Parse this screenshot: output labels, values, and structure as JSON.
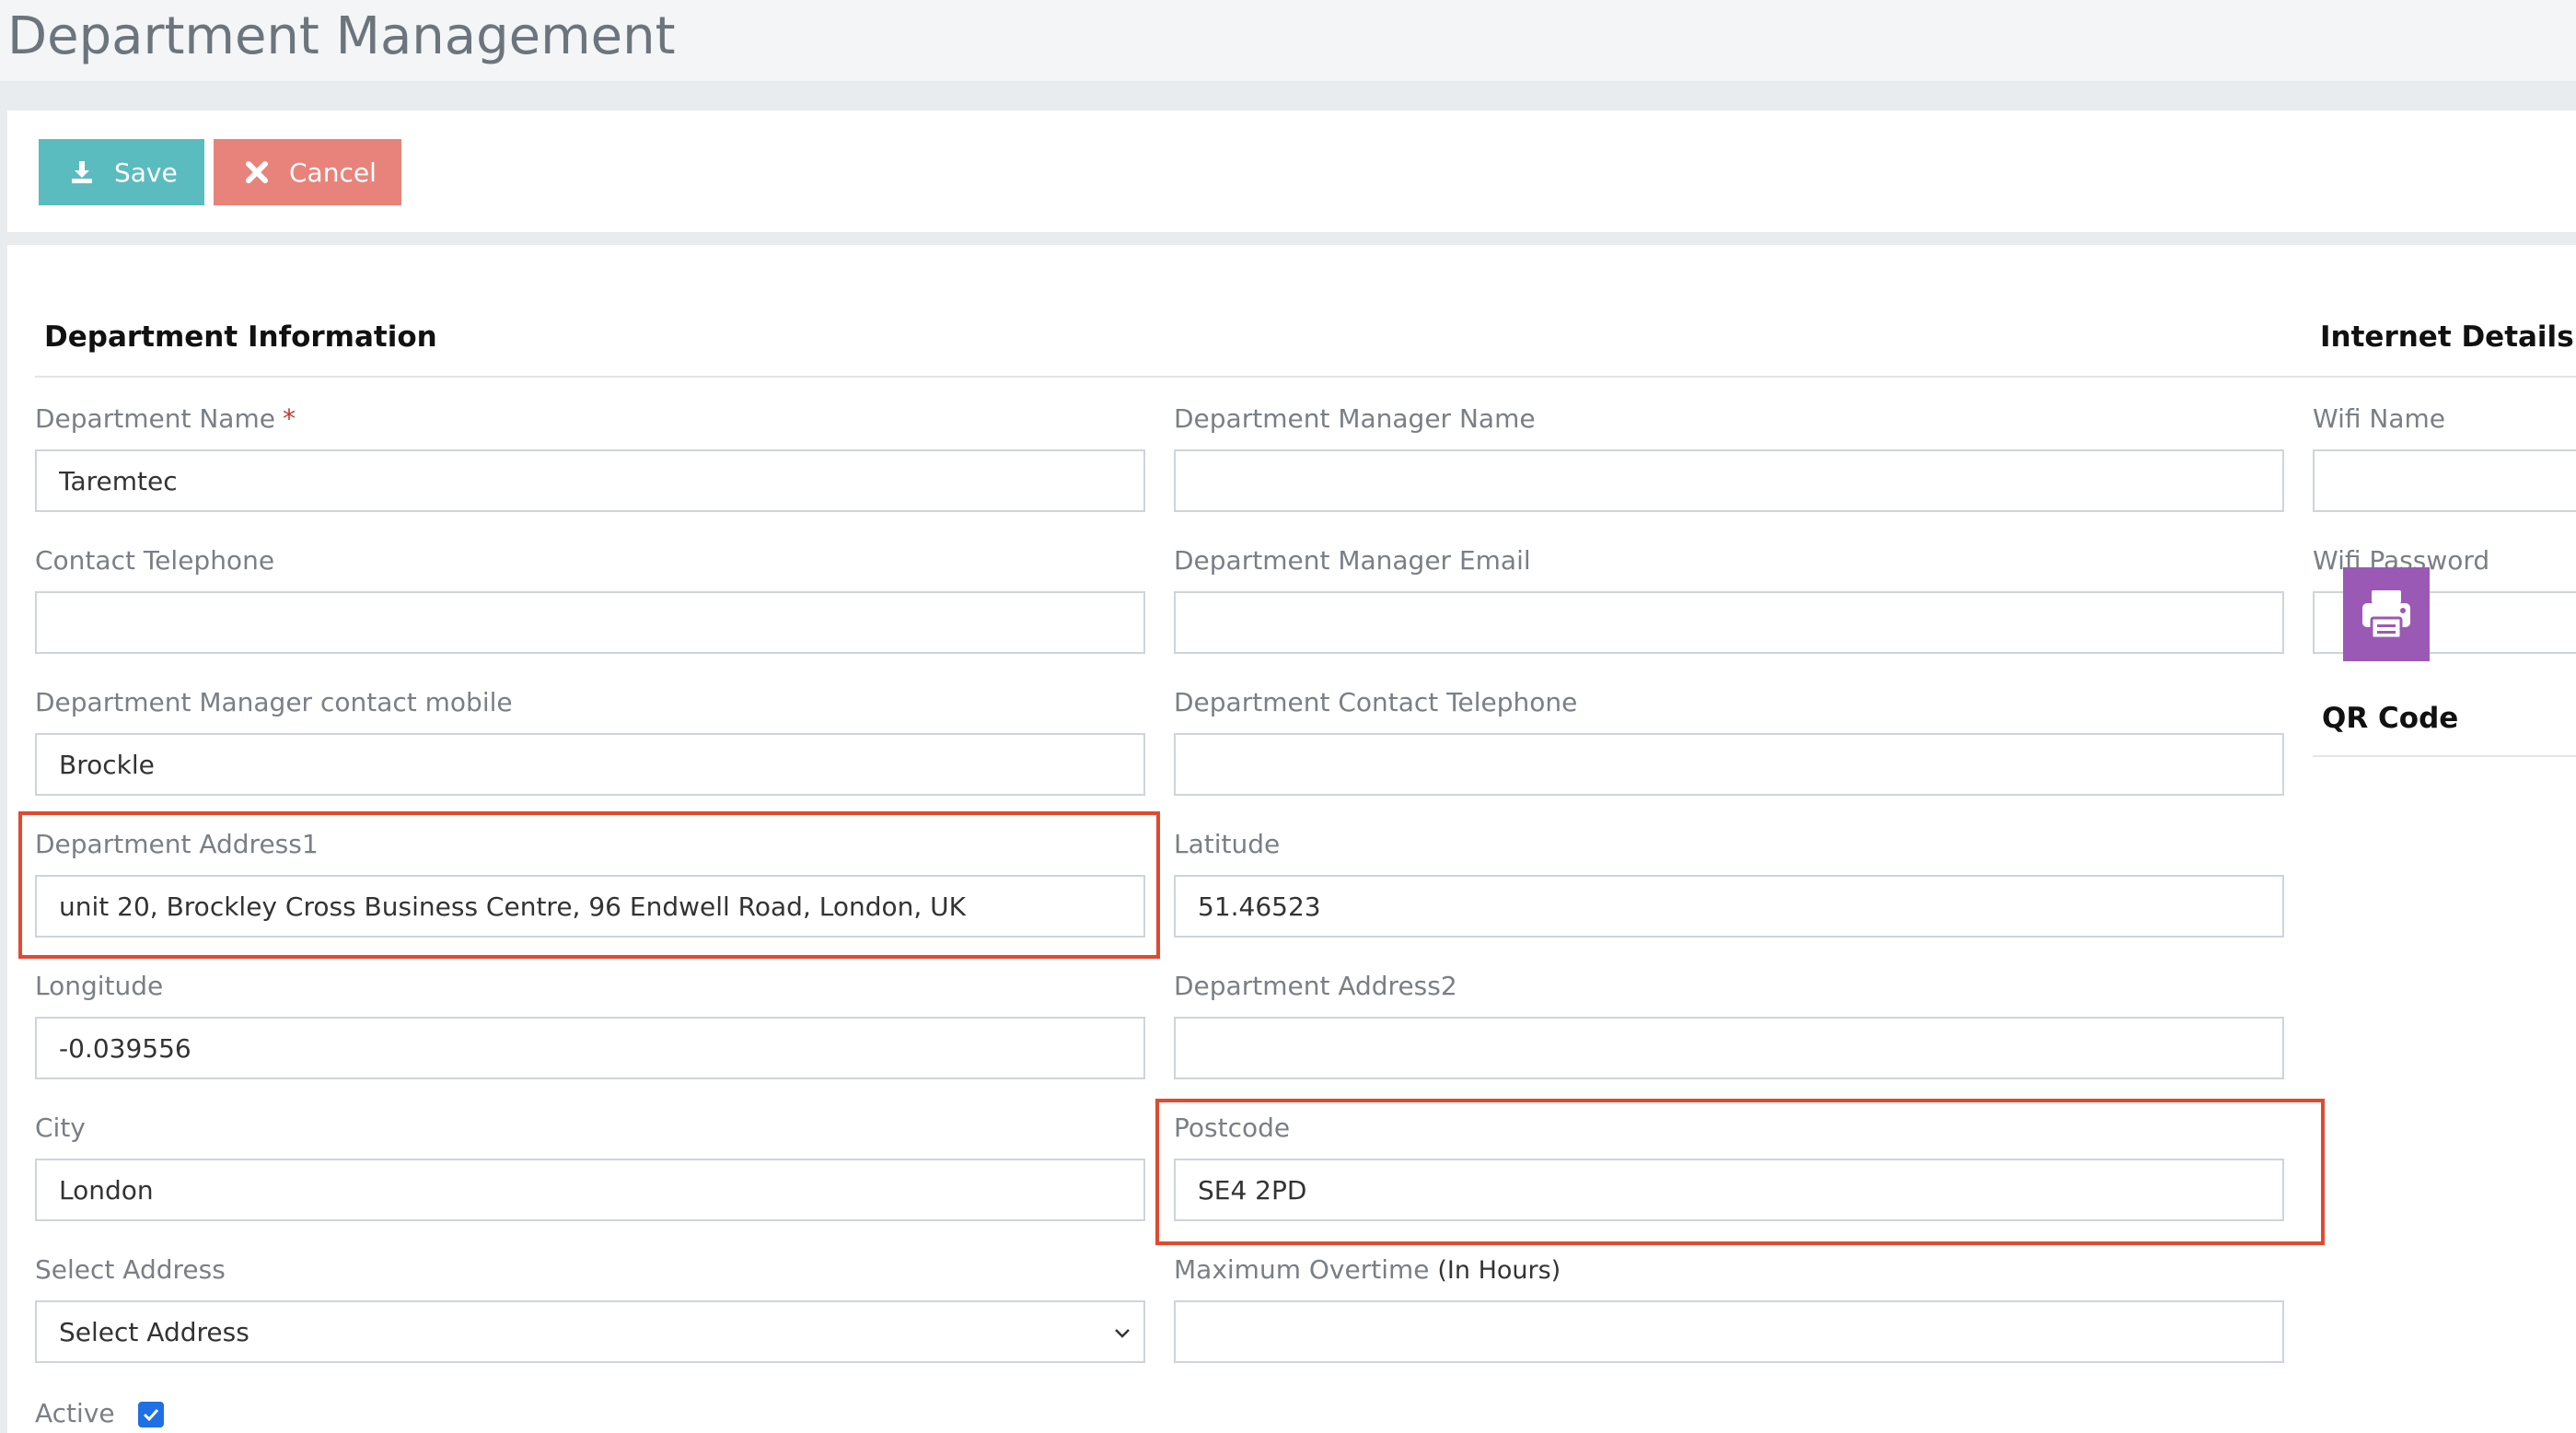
{
  "page": {
    "title": "Department Management"
  },
  "toolbar": {
    "save_label": "Save",
    "cancel_label": "Cancel"
  },
  "sections": {
    "department_information": "Department Information",
    "internet_details": "Internet Details",
    "qr_code": "QR Code"
  },
  "fields": {
    "department_name": {
      "label": "Department Name",
      "required_mark": "*",
      "value": "Taremtec"
    },
    "department_manager_name": {
      "label": "Department Manager Name",
      "value": ""
    },
    "wifi_name": {
      "label": "Wifi Name",
      "value": ""
    },
    "contact_telephone": {
      "label": "Contact Telephone",
      "value": ""
    },
    "department_manager_email": {
      "label": "Department Manager Email",
      "value": ""
    },
    "wifi_password": {
      "label": "Wifi Password",
      "value": ""
    },
    "manager_contact_mobile": {
      "label": "Department Manager contact mobile",
      "value": "Brockle"
    },
    "department_contact_telephone": {
      "label": "Department Contact Telephone",
      "value": ""
    },
    "department_address1": {
      "label": "Department Address1",
      "value": "unit 20, Brockley Cross Business Centre, 96 Endwell Road, London, UK"
    },
    "latitude": {
      "label": "Latitude",
      "value": "51.46523"
    },
    "longitude": {
      "label": "Longitude",
      "value": "-0.039556"
    },
    "department_address2": {
      "label": "Department Address2",
      "value": ""
    },
    "city": {
      "label": "City",
      "value": "London"
    },
    "postcode": {
      "label": "Postcode",
      "value": "SE4 2PD"
    },
    "select_address": {
      "label": "Select Address",
      "selected": "Select Address"
    },
    "maximum_overtime": {
      "label": "Maximum Overtime",
      "label_suffix": "(In Hours)",
      "value": ""
    },
    "active": {
      "label": "Active",
      "checked": true
    }
  },
  "icons": {
    "save": "download-icon",
    "cancel": "close-icon",
    "qr_print": "printer-icon",
    "select_chevron": "chevron-down-icon",
    "active_check": "checkmark-icon"
  },
  "colors": {
    "save_button": "#5bbcbf",
    "cancel_button": "#e8837b",
    "qr_button": "#9b59b6",
    "highlight": "#e04a2f",
    "required": "#c0392b",
    "checkbox": "#1f6fe5"
  }
}
